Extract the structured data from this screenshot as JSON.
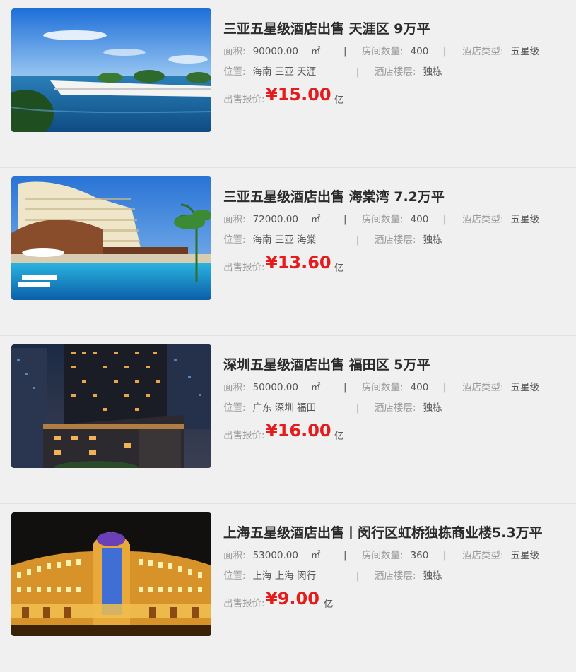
{
  "labels": {
    "area": "面积:",
    "rooms": "房间数量:",
    "type": "酒店类型:",
    "location": "位置:",
    "floor": "酒店楼层:",
    "price": "出售报价:",
    "area_unit": "㎡",
    "separator": "|"
  },
  "listings": [
    {
      "title": "三亚五星级酒店出售 天涯区 9万平",
      "area": "90000.00",
      "rooms": "400",
      "hotel_type": "五星级",
      "location": "海南 三亚 天涯",
      "floor": "独栋",
      "price": "¥15.00",
      "price_unit": "亿",
      "image": "seaside-hotel-photo"
    },
    {
      "title": "三亚五星级酒店出售 海棠湾 7.2万平",
      "area": "72000.00",
      "rooms": "400",
      "hotel_type": "五星级",
      "location": "海南 三亚 海棠",
      "floor": "独栋",
      "price": "¥13.60",
      "price_unit": "亿",
      "image": "resort-pool-photo"
    },
    {
      "title": "深圳五星级酒店出售 福田区 5万平",
      "area": "50000.00",
      "rooms": "400",
      "hotel_type": "五星级",
      "location": "广东 深圳 福田",
      "floor": "独栋",
      "price": "¥16.00",
      "price_unit": "亿",
      "image": "city-night-hotel-photo"
    },
    {
      "title": "上海五星级酒店出售丨闵行区虹桥独栋商业楼5.3万平",
      "area": "53000.00",
      "rooms": "360",
      "hotel_type": "五星级",
      "location": "上海 上海 闵行",
      "floor": "独栋",
      "price": "¥9.00",
      "price_unit": "亿",
      "image": "illuminated-palace-hotel-photo"
    }
  ]
}
